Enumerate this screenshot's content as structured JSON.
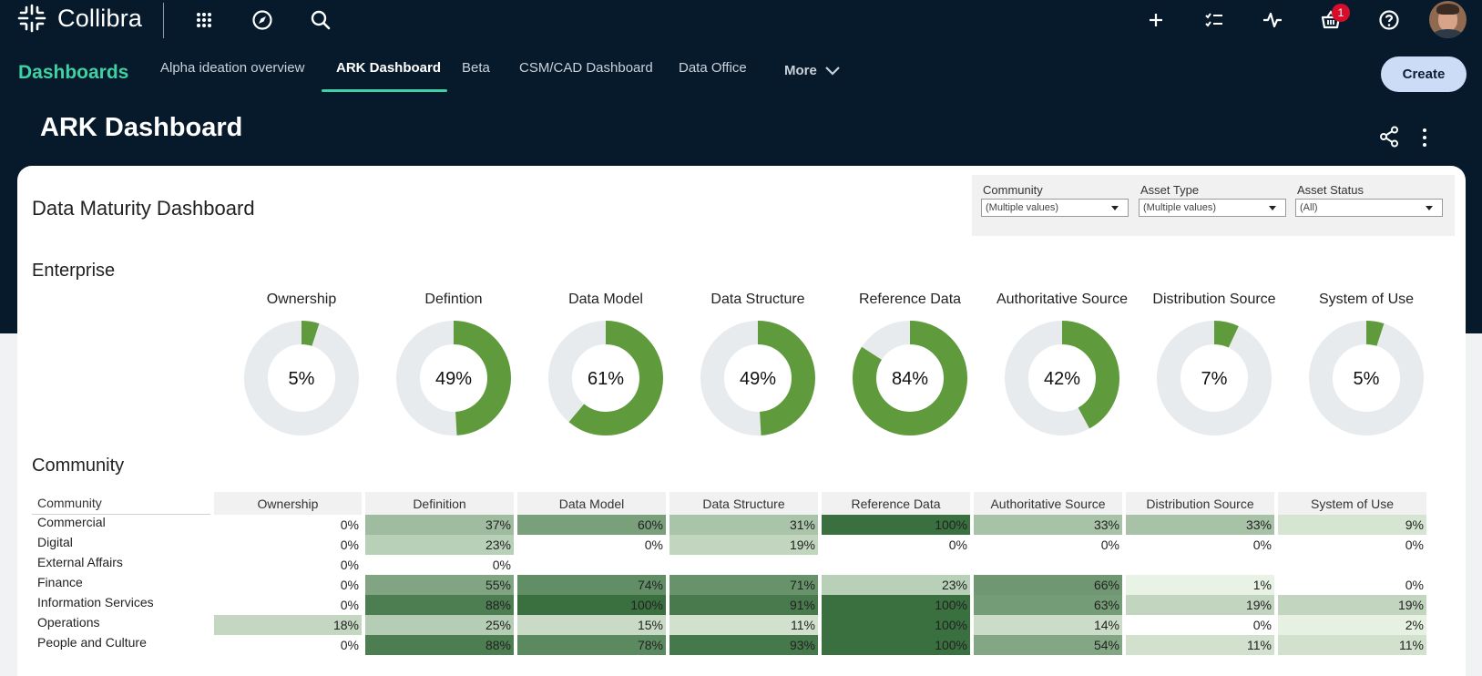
{
  "app": {
    "name": "Collibra",
    "basket_count": "1"
  },
  "nav": {
    "section_title": "Dashboards",
    "tabs": [
      {
        "label": "Alpha ideation overview"
      },
      {
        "label": "ARK Dashboard",
        "active": true
      },
      {
        "label": "Beta"
      },
      {
        "label": "CSM/CAD Dashboard"
      },
      {
        "label": "Data Office"
      }
    ],
    "more_label": "More",
    "create_label": "Create"
  },
  "page": {
    "title": "ARK Dashboard"
  },
  "dashboard": {
    "title": "Data Maturity Dashboard",
    "filters": [
      {
        "label": "Community",
        "value": "(Multiple values)"
      },
      {
        "label": "Asset Type",
        "value": "(Multiple values)"
      },
      {
        "label": "Asset Status",
        "value": "(All)"
      }
    ],
    "enterprise_title": "Enterprise",
    "community_title": "Community",
    "colors": {
      "donut_fill": "#5f9a3c",
      "donut_track": "#e8ebed",
      "accent": "#3fd1a3",
      "navy": "#071a2b"
    },
    "donuts": [
      {
        "label": "Ownership",
        "value": 5,
        "display": "5%"
      },
      {
        "label": "Defintion",
        "value": 49,
        "display": "49%"
      },
      {
        "label": "Data Model",
        "value": 61,
        "display": "61%"
      },
      {
        "label": "Data Structure",
        "value": 49,
        "display": "49%"
      },
      {
        "label": "Reference Data",
        "value": 84,
        "display": "84%"
      },
      {
        "label": "Authoritative Source",
        "value": 42,
        "display": "42%"
      },
      {
        "label": "Distribution Source",
        "value": 7,
        "display": "7%"
      },
      {
        "label": "System of Use",
        "value": 5,
        "display": "5%"
      }
    ],
    "table": {
      "headers": [
        "Community",
        "Ownership",
        "Definition",
        "Data Model",
        "Data Structure",
        "Reference Data",
        "Authoritative Source",
        "Distribution Source",
        "System of Use"
      ],
      "rows": [
        {
          "name": "Commercial",
          "cells": [
            "0%",
            "37%",
            "60%",
            "31%",
            "100%",
            "33%",
            "33%",
            "9%"
          ]
        },
        {
          "name": "Digital",
          "cells": [
            "0%",
            "23%",
            "0%",
            "19%",
            "0%",
            "0%",
            "0%",
            "0%"
          ]
        },
        {
          "name": "External Affairs",
          "cells": [
            "0%",
            "0%",
            "",
            "",
            "",
            "",
            "",
            ""
          ]
        },
        {
          "name": "Finance",
          "cells": [
            "0%",
            "55%",
            "74%",
            "71%",
            "23%",
            "66%",
            "1%",
            "0%"
          ]
        },
        {
          "name": "Information Services",
          "cells": [
            "0%",
            "88%",
            "100%",
            "91%",
            "100%",
            "63%",
            "19%",
            "19%"
          ]
        },
        {
          "name": "Operations",
          "cells": [
            "18%",
            "25%",
            "15%",
            "11%",
            "100%",
            "14%",
            "0%",
            "2%"
          ]
        },
        {
          "name": "People and Culture",
          "cells": [
            "0%",
            "88%",
            "78%",
            "93%",
            "100%",
            "54%",
            "11%",
            "11%"
          ]
        }
      ]
    }
  }
}
